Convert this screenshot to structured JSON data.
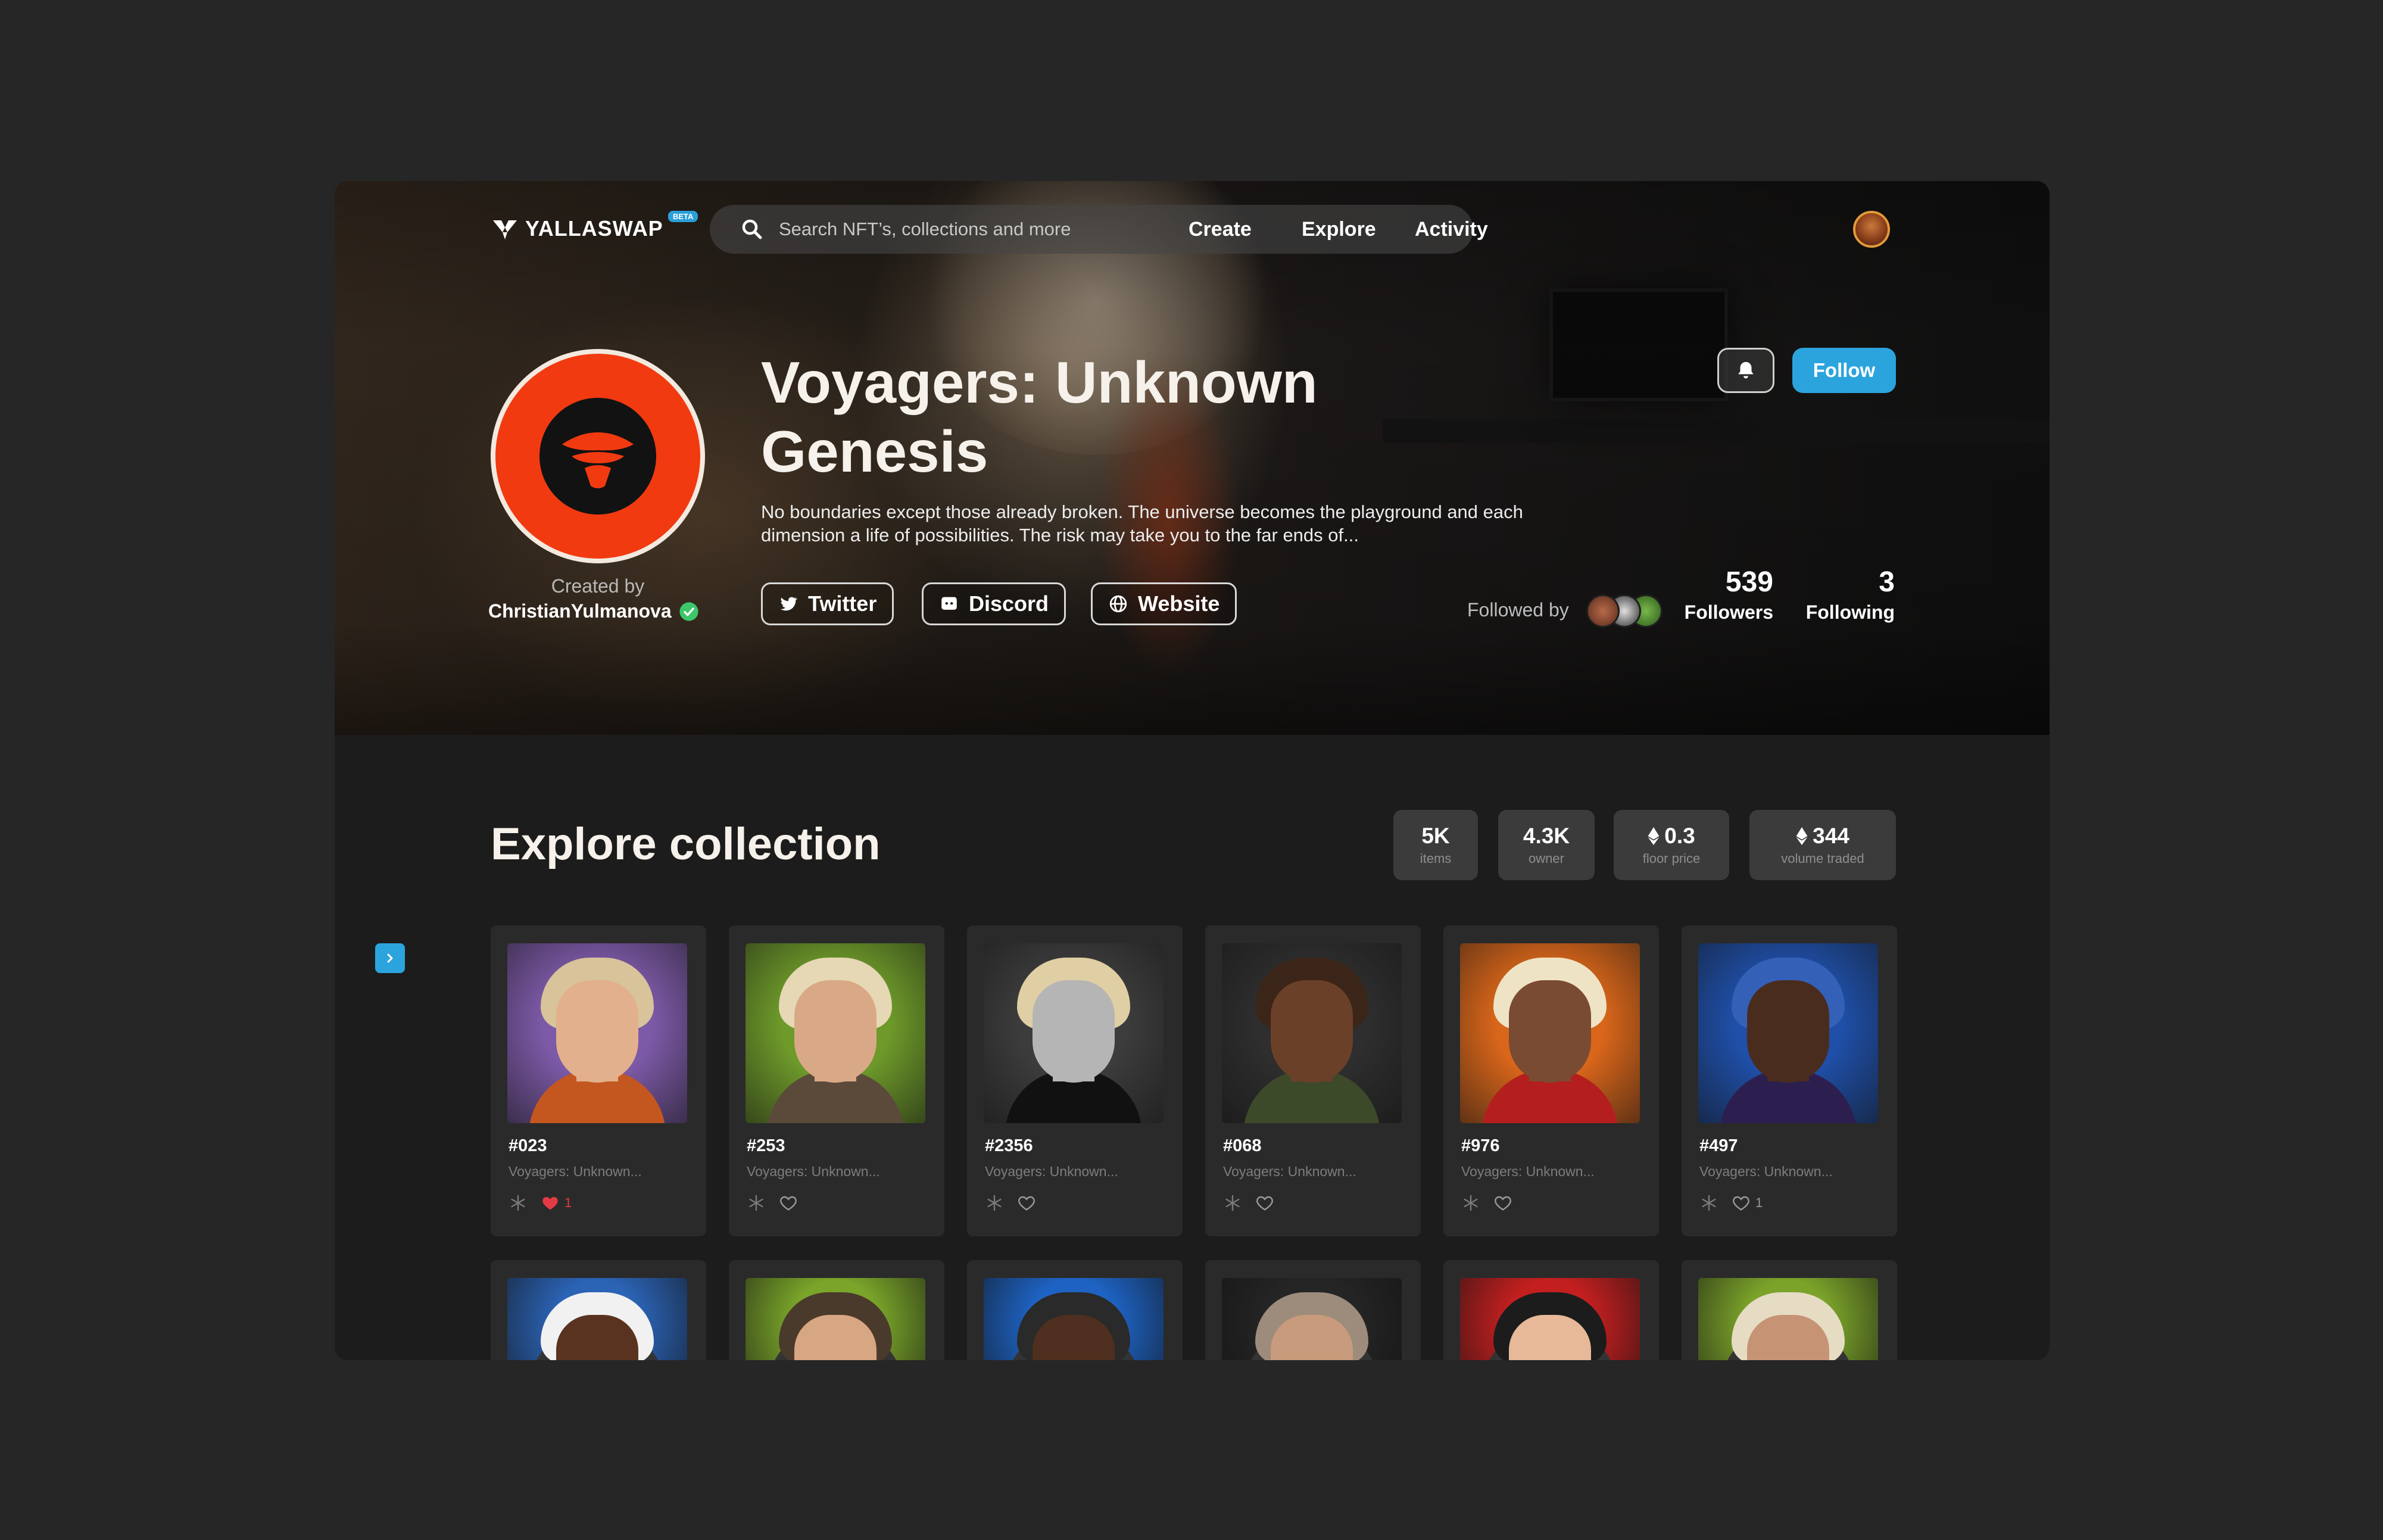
{
  "nav": {
    "brand": "YALLASWAP",
    "badge": "BETA",
    "search_placeholder": "Search NFT’s, collections and more",
    "links": [
      "Create",
      "Explore",
      "Activity"
    ]
  },
  "collection": {
    "title": "Voyagers: Unknown Genesis",
    "description": "No boundaries except those already broken. The universe becomes the playground and each dimension a life of possibilities. The risk may take you to the far ends of...",
    "created_by_label": "Created by",
    "creator": "ChristianYulmanova",
    "socials": [
      "Twitter",
      "Discord",
      "Website"
    ],
    "follow_label": "Follow",
    "followed_by_label": "Followed by",
    "followers": "539",
    "followers_label": "Followers",
    "following": "3",
    "following_label": "Following"
  },
  "explore": {
    "title": "Explore collection",
    "stats": [
      {
        "value": "5K",
        "label": "items",
        "eth": false
      },
      {
        "value": "4.3K",
        "label": "owner",
        "eth": false
      },
      {
        "value": "0.3",
        "label": "floor price",
        "eth": true
      },
      {
        "value": "344",
        "label": "volume traded",
        "eth": true
      }
    ]
  },
  "items": [
    {
      "name": "#023",
      "collection": "Voyagers: Unknown...",
      "liked": true,
      "likes": "1",
      "bg": "#7d5aa8",
      "hair": "#d8c39a",
      "skin": "#e2b08c",
      "shirt": "#c4571f"
    },
    {
      "name": "#253",
      "collection": "Voyagers: Unknown...",
      "liked": false,
      "likes": "",
      "bg": "#6e9a2a",
      "hair": "#e6d8b5",
      "skin": "#d9a987",
      "shirt": "#5b4a3a"
    },
    {
      "name": "#2356",
      "collection": "Voyagers: Unknown...",
      "liked": false,
      "likes": "",
      "bg": "#3c3c3c",
      "hair": "#e0cfa4",
      "skin": "#b5b5b5",
      "shirt": "#111111"
    },
    {
      "name": "#068",
      "collection": "Voyagers: Unknown...",
      "liked": false,
      "likes": "",
      "bg": "#2e2e2e",
      "hair": "#3b2518",
      "skin": "#6b4028",
      "shirt": "#3d4a2a"
    },
    {
      "name": "#976",
      "collection": "Voyagers: Unknown...",
      "liked": false,
      "likes": "",
      "bg": "#d9661a",
      "hair": "#efe3c6",
      "skin": "#7a4b33",
      "shirt": "#b41e1e"
    },
    {
      "name": "#497",
      "collection": "Voyagers: Unknown...",
      "liked": false,
      "likes": "1",
      "bg": "#1f4fa8",
      "hair": "#3460b8",
      "skin": "#4a2c1f",
      "shirt": "#2c1f4f"
    }
  ],
  "items_row2": [
    {
      "bg": "#2b63b5",
      "hair": "#f1f1f1",
      "skin": "#5a3320"
    },
    {
      "bg": "#7aa52a",
      "hair": "#4a3a2c",
      "skin": "#d7a682"
    },
    {
      "bg": "#1e63c4",
      "hair": "#2a2a2a",
      "skin": "#4f2f1f"
    },
    {
      "bg": "#252525",
      "hair": "#9d8c7c",
      "skin": "#c79b7c"
    },
    {
      "bg": "#c41f1f",
      "hair": "#1c1c1c",
      "skin": "#e7b999"
    },
    {
      "bg": "#7ba32a",
      "hair": "#e6dcc4",
      "skin": "#c69475"
    }
  ],
  "colors": {
    "accent": "#2ba4dd",
    "like": "#e33a45",
    "logo_red": "#f23a10"
  }
}
